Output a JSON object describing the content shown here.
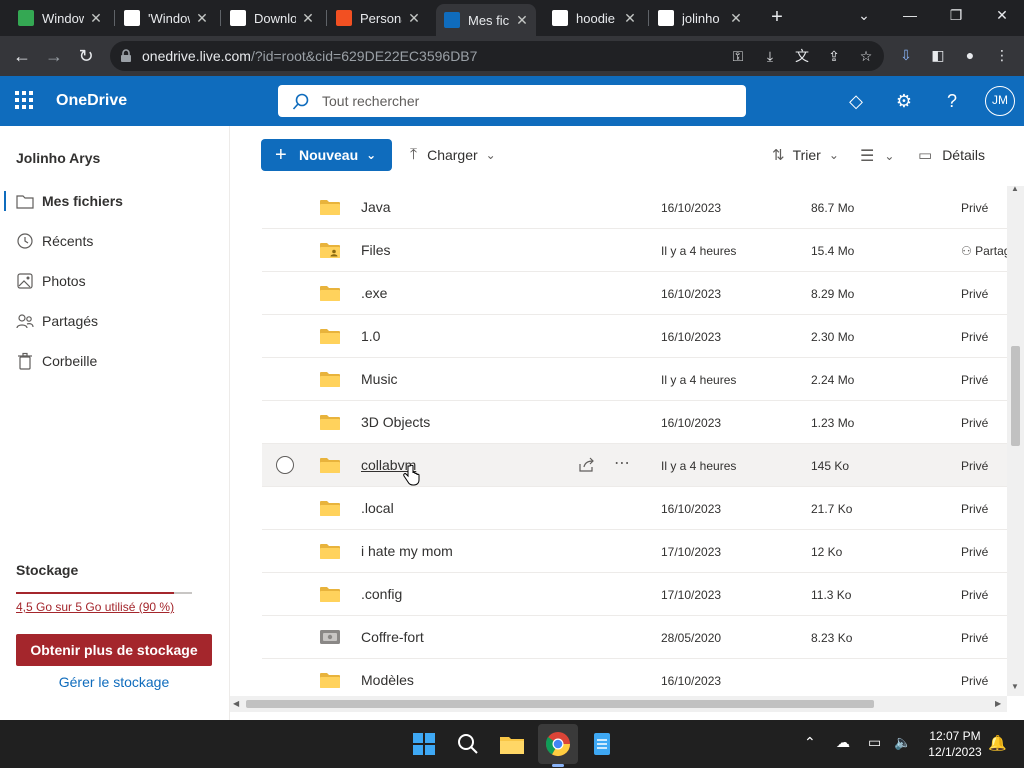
{
  "browser": {
    "tabs": [
      {
        "label": "Windows",
        "favicon_color": "#34a853"
      },
      {
        "label": "'Windows",
        "favicon_color": "#ffffff"
      },
      {
        "label": "Downloads",
        "favicon_color": "#ffffff"
      },
      {
        "label": "Personal",
        "favicon_color": "#f25022"
      },
      {
        "label": "Mes fichiers",
        "favicon_color": "#0f6cbd"
      },
      {
        "label": "hoodie",
        "favicon_color": "#ffffff"
      },
      {
        "label": "jolinho",
        "favicon_color": "#ffffff"
      }
    ],
    "active_tab_index": 4,
    "url_host": "onedrive.live.com",
    "url_path": "/?id=root&cid=629DE22EC3596DB7"
  },
  "header": {
    "title": "OneDrive",
    "search_placeholder": "Tout rechercher",
    "avatar_initials": "JM",
    "accent": "#0f6cbd"
  },
  "sidebar": {
    "user_name": "Jolinho Arys",
    "items": [
      {
        "label": "Mes fichiers",
        "icon": "folder-icon",
        "active": true
      },
      {
        "label": "Récents",
        "icon": "history-icon",
        "active": false
      },
      {
        "label": "Photos",
        "icon": "image-icon",
        "active": false
      },
      {
        "label": "Partagés",
        "icon": "people-icon",
        "active": false
      },
      {
        "label": "Corbeille",
        "icon": "trash-icon",
        "active": false
      }
    ],
    "storage": {
      "title": "Stockage",
      "used_text": "4,5 Go sur 5 Go utilisé (90 %)",
      "used_fraction": 0.9,
      "cta": "Obtenir plus de stockage",
      "manage": "Gérer le stockage"
    }
  },
  "commandbar": {
    "new_label": "Nouveau",
    "upload_label": "Charger",
    "sort_label": "Trier",
    "details_label": "Détails"
  },
  "files": [
    {
      "name": "Java",
      "date": "16/10/2023",
      "size": "86.7 Mo",
      "sharing": "Privé",
      "type": "folder"
    },
    {
      "name": "Files",
      "date": "Il y a 4 heures",
      "size": "15.4 Mo",
      "sharing": "Partagé",
      "type": "shared-folder"
    },
    {
      "name": ".exe",
      "date": "16/10/2023",
      "size": "8.29 Mo",
      "sharing": "Privé",
      "type": "folder"
    },
    {
      "name": "1.0",
      "date": "16/10/2023",
      "size": "2.30 Mo",
      "sharing": "Privé",
      "type": "folder"
    },
    {
      "name": "Music",
      "date": "Il y a 4 heures",
      "size": "2.24 Mo",
      "sharing": "Privé",
      "type": "folder"
    },
    {
      "name": "3D Objects",
      "date": "16/10/2023",
      "size": "1.23 Mo",
      "sharing": "Privé",
      "type": "folder"
    },
    {
      "name": "collabvm",
      "date": "Il y a 4 heures",
      "size": "145 Ko",
      "sharing": "Privé",
      "type": "folder",
      "hover": true
    },
    {
      "name": ".local",
      "date": "16/10/2023",
      "size": "21.7 Ko",
      "sharing": "Privé",
      "type": "folder"
    },
    {
      "name": "i hate my mom",
      "date": "17/10/2023",
      "size": "12 Ko",
      "sharing": "Privé",
      "type": "folder"
    },
    {
      "name": ".config",
      "date": "17/10/2023",
      "size": "11.3 Ko",
      "sharing": "Privé",
      "type": "folder"
    },
    {
      "name": "Coffre-fort",
      "date": "28/05/2020",
      "size": "8.23 Ko",
      "sharing": "Privé",
      "type": "vault"
    },
    {
      "name": "Modèles",
      "date": "16/10/2023",
      "size": "",
      "sharing": "Privé",
      "type": "folder"
    }
  ],
  "taskbar": {
    "time": "12:07 PM",
    "date": "12/1/2023"
  }
}
